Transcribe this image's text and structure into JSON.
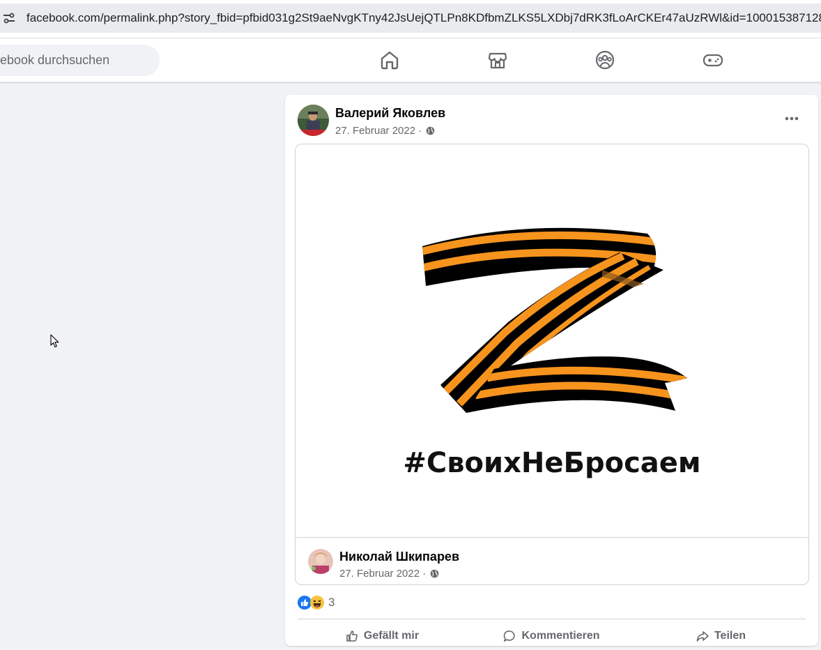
{
  "browser": {
    "url": "facebook.com/permalink.php?story_fbid=pfbid031g2St9aeNvgKTny42JsUejQTLPn8KDfbmZLKS5LXDbj7dRK3fLoArCKEr47aUzRWl&id=100015387128"
  },
  "topnav": {
    "search_placeholder": "ebook durchsuchen",
    "icons": [
      "home-icon",
      "marketplace-icon",
      "groups-icon",
      "gaming-icon"
    ]
  },
  "post": {
    "author": "Валерий Яковлев",
    "date": "27. Februar 2022 ·",
    "audience_icon": "globe-icon",
    "shared": {
      "hashtag": "#СвоихНеБросаем",
      "author": "Николай Шкипарев",
      "date": "27. Februar 2022 ·"
    },
    "reactions": {
      "types": [
        "like",
        "haha"
      ],
      "count": "3"
    },
    "actions": [
      "Gefällt mir",
      "Kommentieren",
      "Teilen"
    ]
  },
  "colors": {
    "accent": "#1877f2",
    "ribbon_orange": "#f7941d",
    "ribbon_black": "#000000",
    "background": "#f0f2f5"
  }
}
